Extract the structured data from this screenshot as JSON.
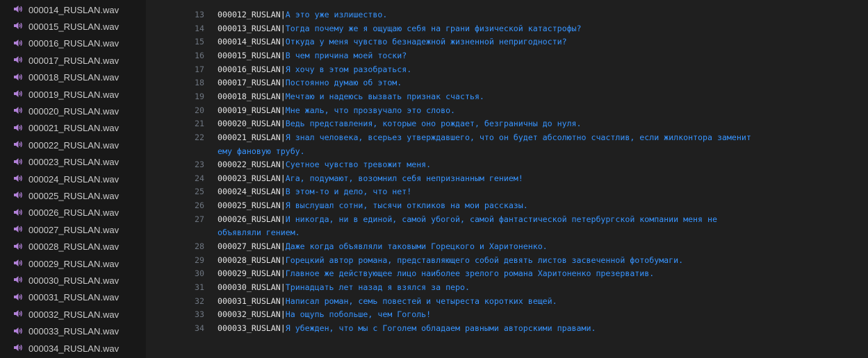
{
  "explorer": {
    "files": [
      "000014_RUSLAN.wav",
      "000015_RUSLAN.wav",
      "000016_RUSLAN.wav",
      "000017_RUSLAN.wav",
      "000018_RUSLAN.wav",
      "000019_RUSLAN.wav",
      "000020_RUSLAN.wav",
      "000021_RUSLAN.wav",
      "000022_RUSLAN.wav",
      "000023_RUSLAN.wav",
      "000024_RUSLAN.wav",
      "000025_RUSLAN.wav",
      "000026_RUSLAN.wav",
      "000027_RUSLAN.wav",
      "000028_RUSLAN.wav",
      "000029_RUSLAN.wav",
      "000030_RUSLAN.wav",
      "000031_RUSLAN.wav",
      "000032_RUSLAN.wav",
      "000033_RUSLAN.wav",
      "000034_RUSLAN.wav"
    ],
    "icon": "speaker-icon",
    "icon_color": "#b180d7"
  },
  "editor": {
    "separator": "|",
    "lines": [
      {
        "n": "13",
        "key": "000012_RUSLAN",
        "text": "А это уже излишество."
      },
      {
        "n": "14",
        "key": "000013_RUSLAN",
        "text": "Тогда почему же я ощущаю себя на грани физической катастрофы?"
      },
      {
        "n": "15",
        "key": "000014_RUSLAN",
        "text": "Откуда у меня чувство безнадежной жизненной непригодности?"
      },
      {
        "n": "16",
        "key": "000015_RUSLAN",
        "text": "В чем причина моей тоски?"
      },
      {
        "n": "17",
        "key": "000016_RUSLAN",
        "text": "Я хочу в этом разобраться."
      },
      {
        "n": "18",
        "key": "000017_RUSLAN",
        "text": "Постоянно думаю об этом."
      },
      {
        "n": "19",
        "key": "000018_RUSLAN",
        "text": "Мечтаю и надеюсь вызвать признак счастья."
      },
      {
        "n": "20",
        "key": "000019_RUSLAN",
        "text": "Мне жаль, что прозвучало это слово."
      },
      {
        "n": "21",
        "key": "000020_RUSLAN",
        "text": "Ведь представления, которые оно рождает, безграничны до нуля."
      },
      {
        "n": "22",
        "key": "000021_RUSLAN",
        "text": "Я знал человека, всерьез утверждавшего, что он будет абсолютно счастлив, если жилконтора заменит",
        "cont": "ему фановую трубу."
      },
      {
        "n": "23",
        "key": "000022_RUSLAN",
        "text": "Суетное чувство тревожит меня."
      },
      {
        "n": "24",
        "key": "000023_RUSLAN",
        "text": "Ага, подумают, возомнил себя непризнанным гением!"
      },
      {
        "n": "25",
        "key": "000024_RUSLAN",
        "text": "В этом-то и дело, что нет!"
      },
      {
        "n": "26",
        "key": "000025_RUSLAN",
        "text": "Я выслушал сотни, тысячи откликов на мои рассказы."
      },
      {
        "n": "27",
        "key": "000026_RUSLAN",
        "text": "И никогда, ни в единой, самой убогой, самой фантастической петербургской компании меня не",
        "cont": "объявляли гением."
      },
      {
        "n": "28",
        "key": "000027_RUSLAN",
        "text": "Даже когда объявляли таковыми Горецкого и Харитоненко."
      },
      {
        "n": "29",
        "key": "000028_RUSLAN",
        "text": "Горецкий автор романа, представляющего собой девять листов засвеченной фотобумаги."
      },
      {
        "n": "30",
        "key": "000029_RUSLAN",
        "text": "Главное же действующее лицо наиболее зрелого романа Харитоненко презерватив."
      },
      {
        "n": "31",
        "key": "000030_RUSLAN",
        "text": "Тринадцать лет назад я взялся за перо."
      },
      {
        "n": "32",
        "key": "000031_RUSLAN",
        "text": "Написал роман, семь повестей и четыреста коротких вещей."
      },
      {
        "n": "33",
        "key": "000032_RUSLAN",
        "text": "На ощупь побольше, чем Гоголь!"
      },
      {
        "n": "34",
        "key": "000033_RUSLAN",
        "text": "Я убежден, что мы с Гоголем обладаем равными авторскими правами."
      }
    ]
  }
}
